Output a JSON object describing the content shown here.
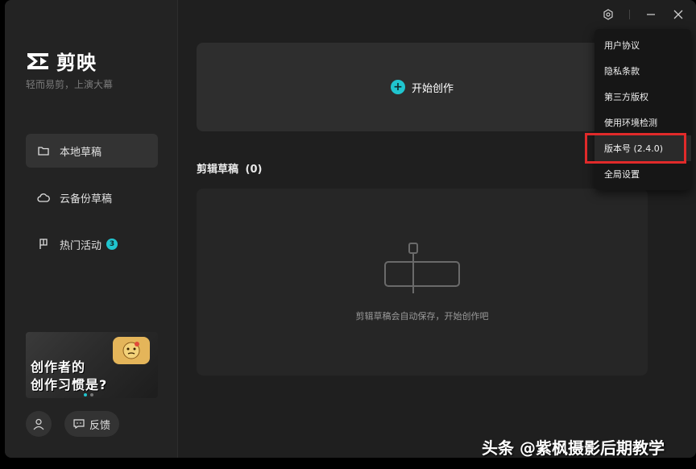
{
  "app": {
    "name": "剪映",
    "slogan": "轻而易剪，上演大幕"
  },
  "sidebar": {
    "items": [
      {
        "label": "本地草稿",
        "icon": "folder-icon",
        "active": true
      },
      {
        "label": "云备份草稿",
        "icon": "cloud-icon",
        "active": false
      },
      {
        "label": "热门活动",
        "icon": "flag-icon",
        "active": false,
        "badge": "3"
      }
    ],
    "banner": {
      "line1": "创作者的",
      "line2": "创作习惯是?"
    },
    "feedback_label": "反馈"
  },
  "main": {
    "create_label": "开始创作",
    "drafts_title": "剪辑草稿",
    "drafts_count": "(0)",
    "empty_text": "剪辑草稿会自动保存，开始创作吧"
  },
  "menu": {
    "items": [
      {
        "label": "用户协议"
      },
      {
        "label": "隐私条款"
      },
      {
        "label": "第三方版权"
      },
      {
        "label": "使用环境检测"
      },
      {
        "label": "版本号 (2.4.0)"
      },
      {
        "label": "全局设置"
      }
    ]
  },
  "watermark": "头条 @紫枫摄影后期教学",
  "colors": {
    "accent": "#20c5cf",
    "highlight": "#e12a2a",
    "bg": "#1f1f1f"
  }
}
